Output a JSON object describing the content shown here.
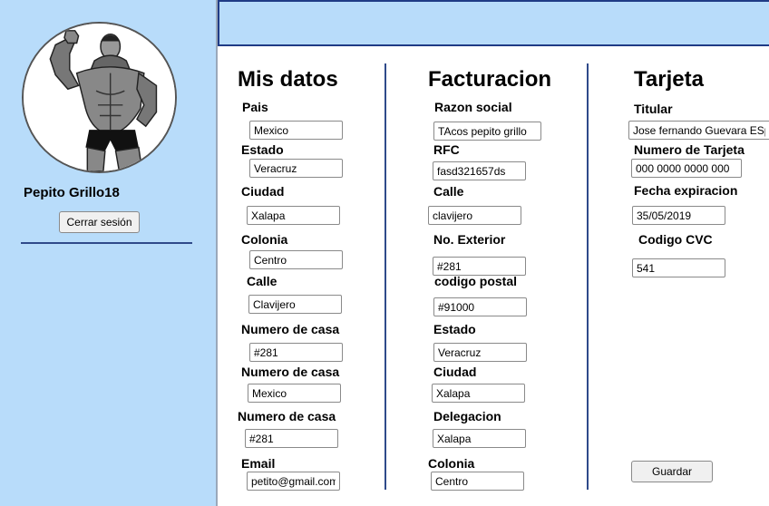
{
  "sidebar": {
    "username": "Pepito Grillo18",
    "logout_label": "Cerrar sesión"
  },
  "mis_datos": {
    "title": "Mis datos",
    "pais_label": "Pais",
    "pais_value": "Mexico",
    "estado_label": "Estado",
    "estado_value": "Veracruz",
    "ciudad_label": "Ciudad",
    "ciudad_value": "Xalapa",
    "colonia_label": "Colonia",
    "colonia_value": "Centro",
    "calle_label": "Calle",
    "calle_value": "Clavijero",
    "numero_casa_1_label": "Numero de casa",
    "numero_casa_1_value": "#281",
    "numero_casa_2_label": "Numero de casa",
    "numero_casa_2_value": "Mexico",
    "numero_casa_3_label": "Numero de casa",
    "numero_casa_3_value": "#281",
    "email_label": "Email",
    "email_value": "petito@gmail.com"
  },
  "facturacion": {
    "title": "Facturacion",
    "razon_social_label": "Razon social",
    "razon_social_value": "TAcos pepito grillo",
    "rfc_label": "RFC",
    "rfc_value": "fasd321657ds",
    "calle_label": "Calle",
    "calle_value": "clavijero",
    "no_exterior_label": "No. Exterior",
    "no_exterior_value": "#281",
    "codigo_postal_label": "codigo postal",
    "codigo_postal_value": "#91000",
    "estado_label": "Estado",
    "estado_value": "Veracruz",
    "ciudad_label": "Ciudad",
    "ciudad_value": "Xalapa",
    "delegacion_label": "Delegacion",
    "delegacion_value": "Xalapa",
    "colonia_label": "Colonia",
    "colonia_value": "Centro"
  },
  "tarjeta": {
    "title": "Tarjeta",
    "titular_label": "Titular",
    "titular_value": "Jose fernando Guevara ESpinoza",
    "numero_tarjeta_label": "Numero de Tarjeta",
    "numero_tarjeta_value": "000 0000 0000 000",
    "fecha_expiracion_label": "Fecha expiracion",
    "fecha_expiracion_value": "35/05/2019",
    "codigo_cvc_label": "Codigo CVC",
    "codigo_cvc_value": "541",
    "save_label": "Guardar"
  },
  "colors": {
    "sidebar_bg": "#b8dcfa",
    "header_border": "#1f3b85",
    "divider": "#2f4a8a"
  }
}
